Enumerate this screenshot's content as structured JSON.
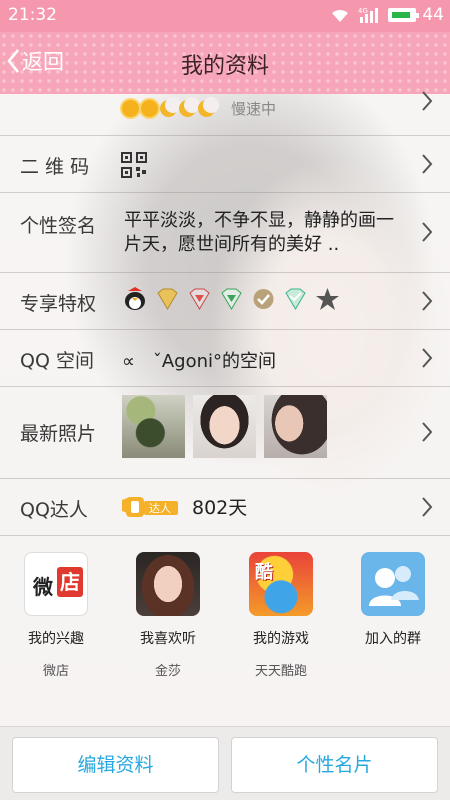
{
  "status_bar": {
    "time": "21:32",
    "network": "4G",
    "battery": "44",
    "color": "#f598ae"
  },
  "header": {
    "back_label": "返回",
    "title": "我的资料",
    "color": "#f7a6b9"
  },
  "profile": {
    "level": {
      "icons": [
        "sun-icon",
        "sun-icon",
        "moon-icon",
        "moon-icon",
        "moon-icon"
      ],
      "status": "慢速中"
    },
    "qr": {
      "label": "二 维 码",
      "icon": "qr-code-icon"
    },
    "signature": {
      "label": "个性签名",
      "text": "平平淡淡，不争不显，静静的画一片天，愿世间所有的美好 .."
    },
    "privileges": {
      "label": "专享特权",
      "icons": [
        "penguin-icon",
        "diamond-gold-icon",
        "diamond-red-icon",
        "diamond-green-icon",
        "check-badge-icon",
        "diamond-teal-icon",
        "star-icon"
      ]
    },
    "qzone": {
      "label": "QQ 空间",
      "text": "∝　ˇAgoni°的空间"
    },
    "photos": {
      "label": "最新照片",
      "count": 3
    },
    "expert": {
      "label": "QQ达人",
      "badge": "达人",
      "days": "802天"
    }
  },
  "apps": [
    {
      "name": "我的兴趣",
      "sub": "微店",
      "icon": "weidian-icon"
    },
    {
      "name": "我喜欢听",
      "sub": "金莎",
      "icon": "singer-avatar-icon"
    },
    {
      "name": "我的游戏",
      "sub": "天天酷跑",
      "icon": "game-icon"
    },
    {
      "name": "加入的群",
      "sub": "",
      "icon": "group-icon"
    }
  ],
  "bottom": {
    "edit_label": "编辑资料",
    "card_label": "个性名片",
    "accent": "#29a8e0"
  }
}
